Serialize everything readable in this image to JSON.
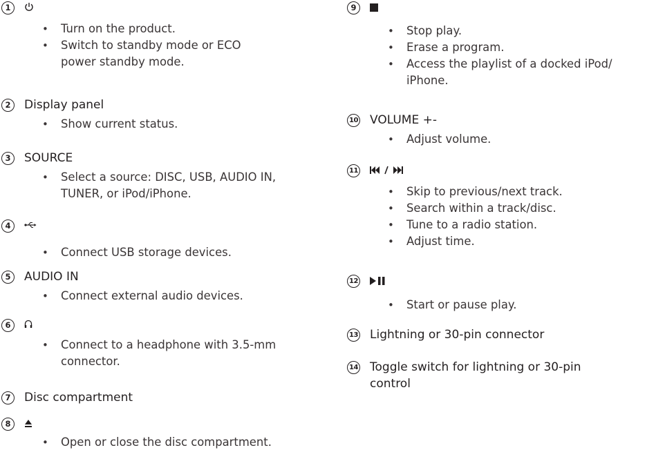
{
  "items": [
    {
      "num": "1",
      "title": "",
      "icon": "power-icon",
      "bullets": [
        "Turn on the product.",
        "Switch to standby mode or ECO",
        "power standby mode."
      ]
    },
    {
      "num": "2",
      "title": "Display panel",
      "bullets": [
        "Show current status."
      ]
    },
    {
      "num": "3",
      "title": "SOURCE",
      "bullets": [
        "Select a source: DISC, USB, AUDIO IN,",
        "TUNER, or iPod/iPhone."
      ]
    },
    {
      "num": "4",
      "title": "",
      "icon": "usb-icon",
      "bullets": [
        "Connect USB storage devices."
      ]
    },
    {
      "num": "5",
      "title": "AUDIO IN",
      "bullets": [
        "Connect external audio devices."
      ]
    },
    {
      "num": "6",
      "title": "",
      "icon": "headphone-icon",
      "bullets": [
        "Connect to a headphone with 3.5-mm",
        "connector."
      ]
    },
    {
      "num": "7",
      "title": "Disc compartment",
      "bullets": []
    },
    {
      "num": "8",
      "title": "",
      "icon": "eject-icon",
      "bullets": [
        "Open or close the disc compartment."
      ]
    },
    {
      "num": "9",
      "title": "",
      "icon": "stop-icon",
      "bullets": [
        "Stop play.",
        "Erase a program.",
        "Access the playlist of a docked iPod/",
        "iPhone."
      ]
    },
    {
      "num": "10",
      "title": "VOLUME +-",
      "bullets": [
        "Adjust volume."
      ]
    },
    {
      "num": "11",
      "title": "",
      "icon": "skip-prev-next-icon",
      "bullets": [
        "Skip to previous/next track.",
        "Search within a track/disc.",
        "Tune to a radio station.",
        "Adjust time."
      ]
    },
    {
      "num": "12",
      "title": "",
      "icon": "play-pause-icon",
      "bullets": [
        "Start or pause play."
      ]
    },
    {
      "num": "13",
      "title": "Lightning or 30-pin connector",
      "bullets": []
    },
    {
      "num": "14",
      "title": "Toggle switch for lightning or 30-pin",
      "title2": "control",
      "bullets": []
    }
  ]
}
